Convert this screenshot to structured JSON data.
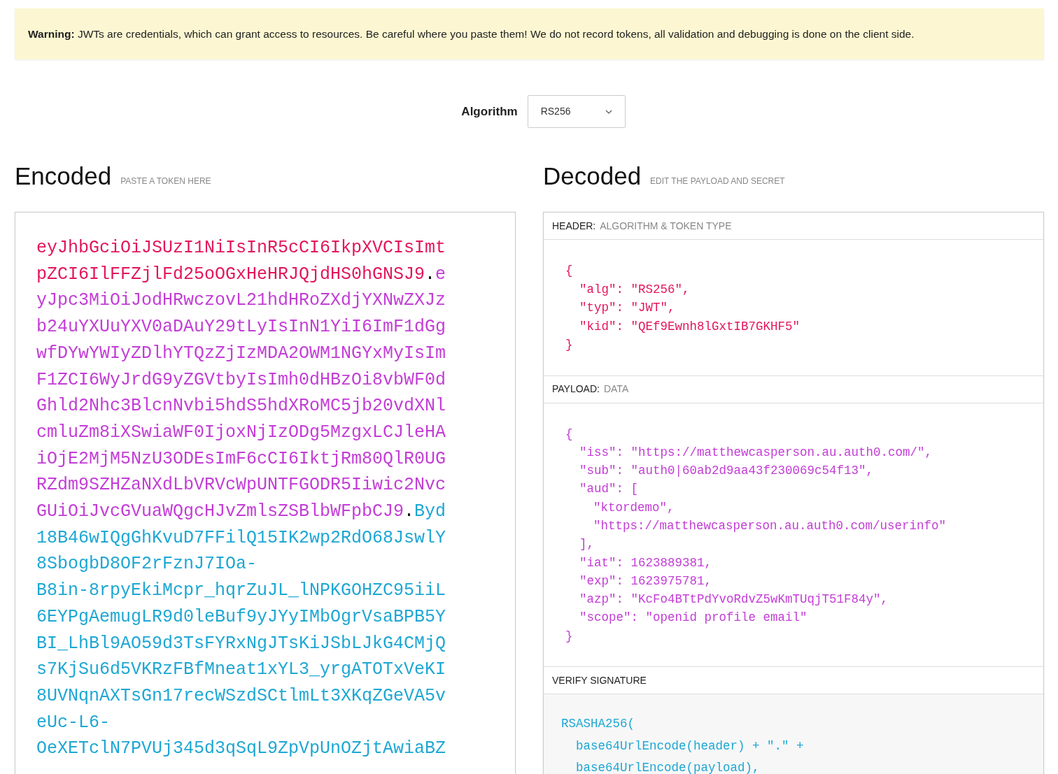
{
  "warning": "**Warning:** JWTs are credentials, which can grant access to resources. Be careful where you paste them! We do not record tokens, all validation and debugging is done on the client side.",
  "algorithm": {
    "label": "Algorithm",
    "value": "RS256"
  },
  "encoded": {
    "title": "Encoded",
    "subtitle": "PASTE A TOKEN HERE",
    "lines": [
      [
        {
          "kind": "header",
          "text": "eyJhbGciOiJSUzI1NiIsInR5cCI6IkpXVCIsImt"
        }
      ],
      [
        {
          "kind": "header",
          "text": "pZCI6IlFFZjlFd25oOGxHeHRJQjdHS0hGNSJ9"
        },
        {
          "kind": "dot",
          "text": "."
        },
        {
          "kind": "payload",
          "text": "e"
        }
      ],
      [
        {
          "kind": "payload",
          "text": "yJpc3MiOiJodHRwczovL21hdHRoZXdjYXNwZXJz"
        }
      ],
      [
        {
          "kind": "payload",
          "text": "b24uYXUuYXV0aDAuY29tLyIsInN1YiI6ImF1dGg"
        }
      ],
      [
        {
          "kind": "payload",
          "text": "wfDYwYWIyZDlhYTQzZjIzMDA2OWM1NGYxMyIsIm"
        }
      ],
      [
        {
          "kind": "payload",
          "text": "F1ZCI6WyJrdG9yZGVtbyIsImh0dHBzOi8vbWF0d"
        }
      ],
      [
        {
          "kind": "payload",
          "text": "Ghld2Nhc3BlcnNvbi5hdS5hdXRoMC5jb20vdXNl"
        }
      ],
      [
        {
          "kind": "payload",
          "text": "cmluZm8iXSwiaWF0IjoxNjIzODg5MzgxLCJleHA"
        }
      ],
      [
        {
          "kind": "payload",
          "text": "iOjE2MjM5NzU3ODEsImF6cCI6IktjRm80QlR0UG"
        }
      ],
      [
        {
          "kind": "payload",
          "text": "RZdm9SZHZaNXdLbVRVcWpUNTFGODR5Iiwic2Nvc"
        }
      ],
      [
        {
          "kind": "payload",
          "text": "GUiOiJvcGVuaWQgcHJvZmlsZSBlbWFpbCJ9"
        },
        {
          "kind": "dot",
          "text": "."
        },
        {
          "kind": "signature",
          "text": "Byd"
        }
      ],
      [
        {
          "kind": "signature",
          "text": "18B46wIQgGhKvuD7FFilQ15IK2wp2RdO68JswlY"
        }
      ],
      [
        {
          "kind": "signature",
          "text": "8SbogbD8OF2rFznJ7IOa-"
        }
      ],
      [
        {
          "kind": "signature",
          "text": "B8in-8rpyEkiMcpr_hqrZuJL_lNPKGOHZC95iiL"
        }
      ],
      [
        {
          "kind": "signature",
          "text": "6EYPgAemugLR9d0leBuf9yJYyIMbOgrVsaBPB5Y"
        }
      ],
      [
        {
          "kind": "signature",
          "text": "BI_LhBl9AO59d3TsFYRxNgJTsKiJSbLJkG4CMjQ"
        }
      ],
      [
        {
          "kind": "signature",
          "text": "s7KjSu6d5VKRzFBfMneat1xYL3_yrgATOTxVeKI"
        }
      ],
      [
        {
          "kind": "signature",
          "text": "8UVNqnAXTsGn17recWSzdSCtlmLt3XKqZGeVA5v"
        }
      ],
      [
        {
          "kind": "signature",
          "text": "eUc-L6-"
        }
      ],
      [
        {
          "kind": "signature",
          "text": "OeXETclN7PVUj345d3qSqL9ZpVpUnOZjtAwiaBZ"
        }
      ]
    ]
  },
  "decoded": {
    "title": "Decoded",
    "subtitle": "EDIT THE PAYLOAD AND SECRET",
    "sections": [
      {
        "kind": "header",
        "label": "HEADER:",
        "sublabel": "ALGORITHM & TOKEN TYPE",
        "lines": [
          {
            "text": "{",
            "children": [
              {
                "text": "\"alg\": \"RS256\","
              },
              {
                "text": "\"typ\": \"JWT\","
              },
              {
                "text": "\"kid\": \"QEf9Ewnh8lGxtIB7GKHF5\""
              }
            ]
          },
          {
            "text": "}"
          }
        ]
      },
      {
        "kind": "payload",
        "label": "PAYLOAD:",
        "sublabel": "DATA",
        "lines": [
          {
            "text": "{",
            "children": [
              {
                "text": "\"iss\": \"https://matthewcasperson.au.auth0.com/\","
              },
              {
                "text": "\"sub\": \"auth0|60ab2d9aa43f230069c54f13\","
              },
              {
                "text": "\"aud\": [",
                "children": [
                  {
                    "text": "\"ktordemo\","
                  },
                  {
                    "text": "\"https://matthewcasperson.au.auth0.com/userinfo\""
                  }
                ]
              },
              {
                "text": "],"
              },
              {
                "text": "\"iat\": 1623889381,"
              },
              {
                "text": "\"exp\": 1623975781,"
              },
              {
                "text": "\"azp\": \"KcFo4BTtPdYvoRdvZ5wKmTUqjT51F84y\","
              },
              {
                "text": "\"scope\": \"openid profile email\""
              }
            ]
          },
          {
            "text": "}"
          }
        ]
      },
      {
        "kind": "signature",
        "label": "VERIFY SIGNATURE",
        "lines": [
          {
            "text": "RSASHA256(",
            "children": [
              {
                "text": "base64UrlEncode(header) + \".\" +"
              },
              {
                "text": "base64UrlEncode(payload),"
              }
            ]
          }
        ]
      }
    ]
  }
}
